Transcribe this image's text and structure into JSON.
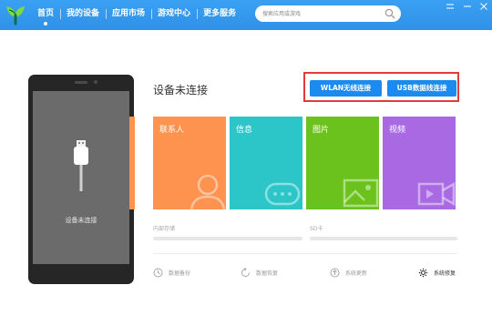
{
  "nav": {
    "items": [
      {
        "label": "首页",
        "active": true
      },
      {
        "label": "我的设备",
        "active": false
      },
      {
        "label": "应用市场",
        "active": false
      },
      {
        "label": "游戏中心",
        "active": false
      },
      {
        "label": "更多服务",
        "active": false
      }
    ]
  },
  "search": {
    "placeholder": "搜索应用或游戏",
    "value": "",
    "icon": "search-icon"
  },
  "phone": {
    "status_text": "设备未连接",
    "icon": "usb-cable-icon"
  },
  "connection": {
    "title": "设备未连接",
    "wlan_button": "WLAN无线连接",
    "usb_button": "USB数据线连接"
  },
  "tiles": [
    {
      "label": "联系人",
      "color": "#fd934e",
      "icon": "contact-icon"
    },
    {
      "label": "信息",
      "color": "#2cc6c8",
      "icon": "message-icon"
    },
    {
      "label": "图片",
      "color": "#6cc21c",
      "icon": "picture-icon"
    },
    {
      "label": "视频",
      "color": "#a969e3",
      "icon": "video-icon"
    }
  ],
  "storage": {
    "internal_label": "内部存储",
    "sd_label": "SD卡"
  },
  "tools": [
    {
      "label": "数据备份",
      "icon": "backup-icon"
    },
    {
      "label": "数据恢复",
      "icon": "restore-icon"
    },
    {
      "label": "系统更新",
      "icon": "update-icon"
    },
    {
      "label": "系统修复",
      "icon": "gear-icon"
    }
  ],
  "colors": {
    "header": "#3197ec",
    "button": "#1c8bef",
    "highlight": "#e43a3a"
  }
}
